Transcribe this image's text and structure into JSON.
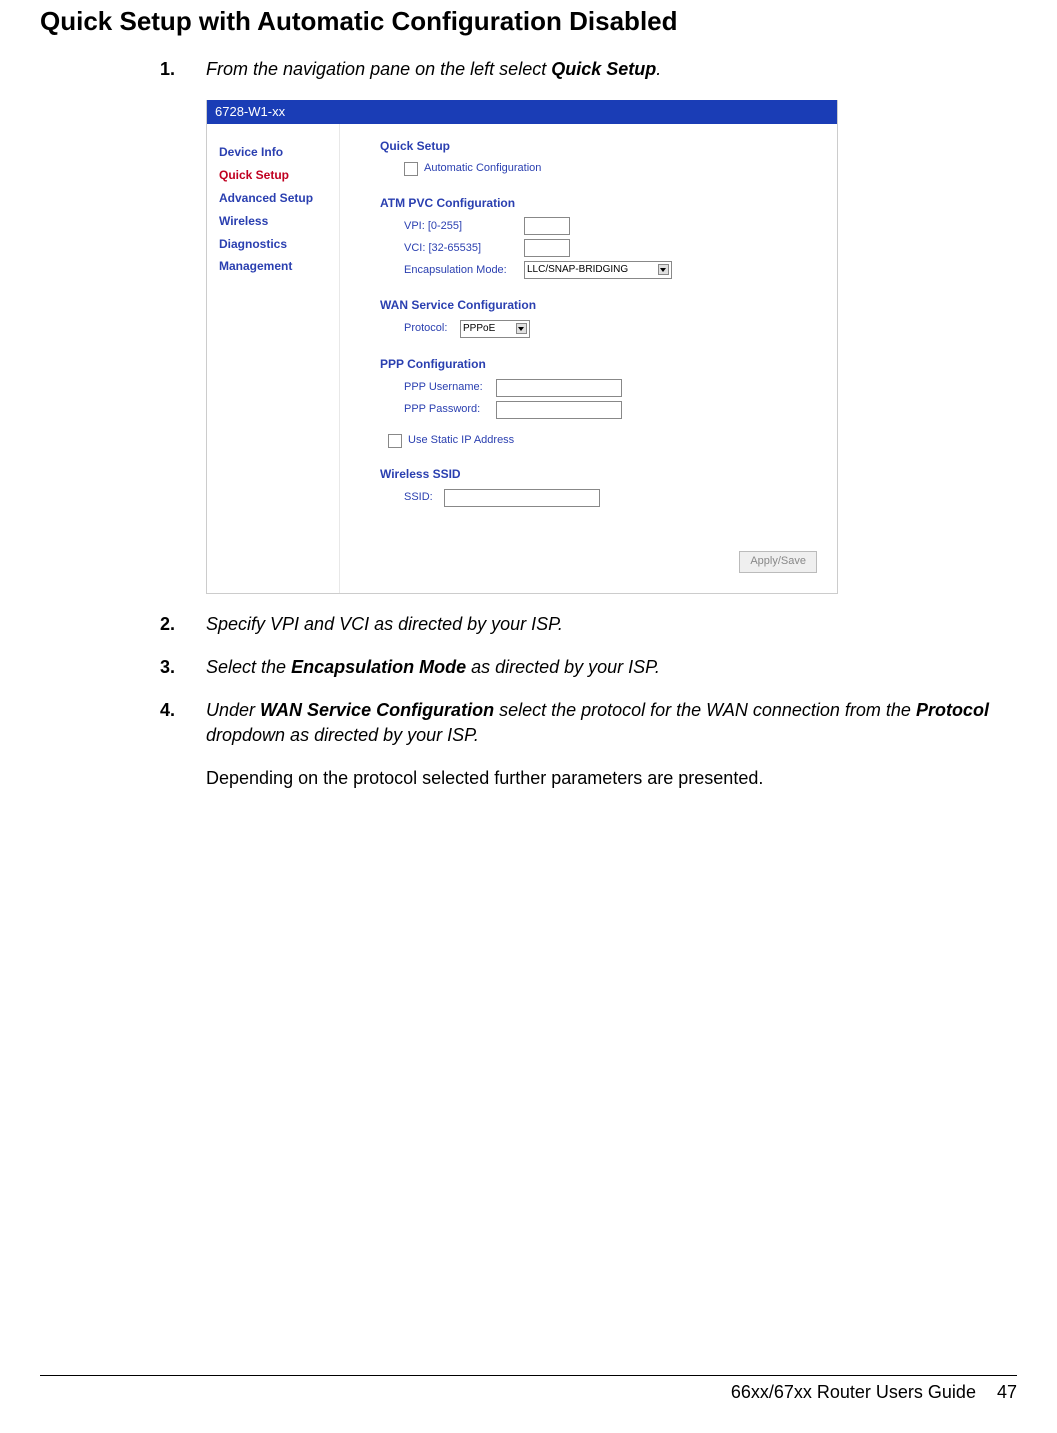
{
  "heading": "Quick Setup with Automatic Configuration Disabled",
  "steps": {
    "s1": {
      "n": "1.",
      "pre": "From the navigation pane on the left select ",
      "b": "Quick Setup",
      "post": "."
    },
    "s2": {
      "n": "2.",
      "text": "Specify VPI and VCI as directed by your ISP."
    },
    "s3": {
      "n": "3.",
      "pre": "Select the ",
      "b": "Encapsulation Mode",
      "post": " as directed by your ISP."
    },
    "s4": {
      "n": "4.",
      "pre": "Under ",
      "b1": "WAN Service Configuration",
      "mid": " select the protocol for the WAN connection from the ",
      "b2": "Protocol",
      "post": " dropdown as directed by your ISP."
    },
    "note": "Depending on the protocol selected further parameters are presented."
  },
  "shot": {
    "title": "6728-W1-xx",
    "nav": [
      "Device Info",
      "Quick Setup",
      "Advanced Setup",
      "Wireless",
      "Diagnostics",
      "Management"
    ],
    "qs_title": "Quick Setup",
    "auto_cfg": "Automatic Configuration",
    "atm_title": "ATM PVC Configuration",
    "vpi": "VPI: [0-255]",
    "vci": "VCI: [32-65535]",
    "encap_lbl": "Encapsulation Mode:",
    "encap_val": "LLC/SNAP-BRIDGING",
    "wan_title": "WAN Service Configuration",
    "proto_lbl": "Protocol:",
    "proto_val": "PPPoE",
    "ppp_title": "PPP Configuration",
    "ppp_user": "PPP Username:",
    "ppp_pass": "PPP Password:",
    "static_ip": "Use Static IP Address",
    "ssid_title": "Wireless SSID",
    "ssid_lbl": "SSID:",
    "apply": "Apply/Save"
  },
  "footer": {
    "title": "66xx/67xx Router Users Guide",
    "page": "47"
  }
}
